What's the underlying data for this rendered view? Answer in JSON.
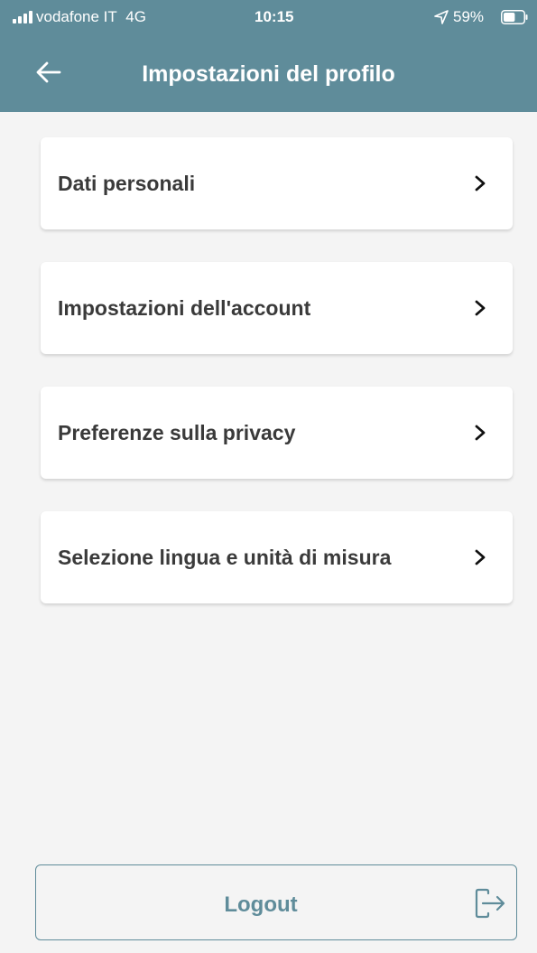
{
  "status_bar": {
    "carrier": "vodafone IT",
    "network": "4G",
    "time": "10:15",
    "battery": "59%",
    "battery_level": 0.59,
    "signal_bars": 4,
    "icons": [
      "signal-icon",
      "location-arrow-icon",
      "battery-icon"
    ]
  },
  "header": {
    "title": "Impostazioni del profilo",
    "back_icon": "arrow-left-icon",
    "background_color": "#5f8c9a"
  },
  "menu": {
    "items": [
      {
        "label": "Dati personali",
        "icon": "chevron-right-icon"
      },
      {
        "label": "Impostazioni dell'account",
        "icon": "chevron-right-icon"
      },
      {
        "label": "Preferenze sulla privacy",
        "icon": "chevron-right-icon"
      },
      {
        "label": "Selezione lingua e unità di misura",
        "icon": "chevron-right-icon"
      }
    ]
  },
  "logout": {
    "label": "Logout",
    "icon": "logout-icon",
    "accent_color": "#5f8c9a"
  }
}
